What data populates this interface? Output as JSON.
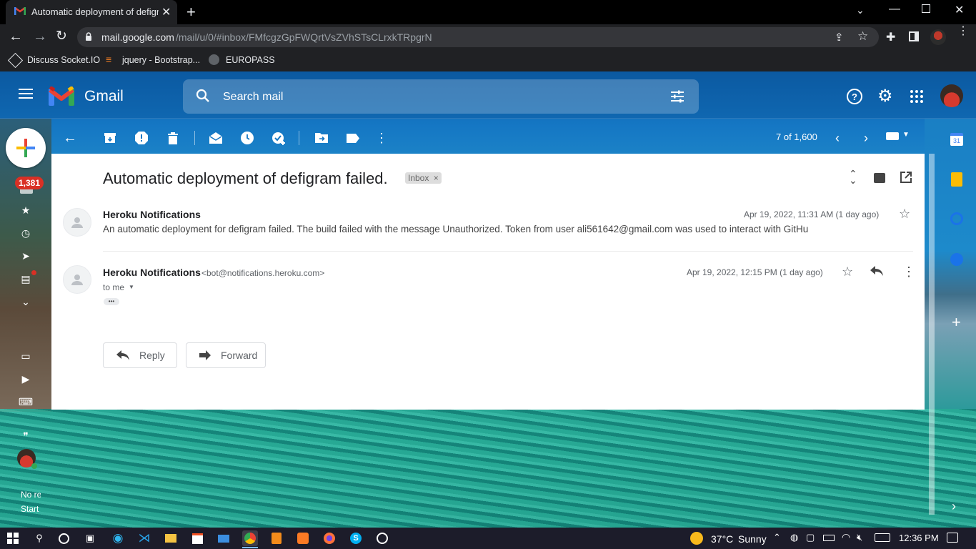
{
  "browser": {
    "tab_title": "Automatic deployment of defigra",
    "new_tab_symbol": "+",
    "url_host": "mail.google.com",
    "url_path": "/mail/u/0/#inbox/FMfcgzGpFWQrtVsZVhSTsCLrxkTRpgrN",
    "bookmarks": [
      "Discuss Socket.IO",
      "jquery - Bootstrap...",
      "EUROPASS"
    ]
  },
  "gmail": {
    "logo_text": "Gmail",
    "search_placeholder": "Search mail",
    "unread_badge": "1,381",
    "pagination": "7 of 1,600",
    "left_bottom_text_1": "No re",
    "left_bottom_text_2": "Start"
  },
  "thread": {
    "subject": "Automatic deployment of defigram failed.",
    "label_chip": "Inbox",
    "label_chip_close": "×",
    "messages": [
      {
        "sender": "Heroku Notifications",
        "date": "Apr 19, 2022, 11:31 AM (1 day ago)",
        "snippet": "An automatic deployment for defigram failed. The build failed with the message Unauthorized. Token from user ali561642@gmail.com was used to interact with GitHu"
      },
      {
        "sender": "Heroku Notifications",
        "email": "<bot@notifications.heroku.com>",
        "date": "Apr 19, 2022, 12:15 PM (1 day ago)",
        "to": "to me",
        "ellipsis": "•••"
      }
    ],
    "reply_label": "Reply",
    "forward_label": "Forward"
  },
  "taskbar": {
    "weather_temp": "37°C",
    "weather_text": "Sunny",
    "time": "12:36 PM"
  },
  "colors": {
    "chrome_bg": "#202124",
    "gmail_accent": "#1a73e8",
    "badge_red": "#d93025",
    "white": "#ffffff"
  }
}
